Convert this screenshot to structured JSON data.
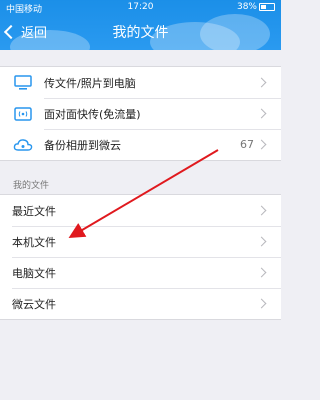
{
  "status": {
    "carrier": "中国移动",
    "time": "17:20",
    "battery": "38%",
    "battery_level": 0.38
  },
  "nav": {
    "back_label": "返回",
    "title": "我的文件"
  },
  "top_items": [
    {
      "label": "传文件/照片到电脑",
      "icon": "monitor-icon"
    },
    {
      "label": "面对面快传(免流量)",
      "icon": "folder-wireless-icon"
    },
    {
      "label": "备份相册到微云",
      "icon": "cloud-icon",
      "count": "67"
    }
  ],
  "section_title": "我的文件",
  "file_items": [
    {
      "label": "最近文件"
    },
    {
      "label": "本机文件"
    },
    {
      "label": "电脑文件"
    },
    {
      "label": "微云文件"
    }
  ],
  "colors": {
    "accent": "#2896ee",
    "arrow": "#e0191e"
  }
}
